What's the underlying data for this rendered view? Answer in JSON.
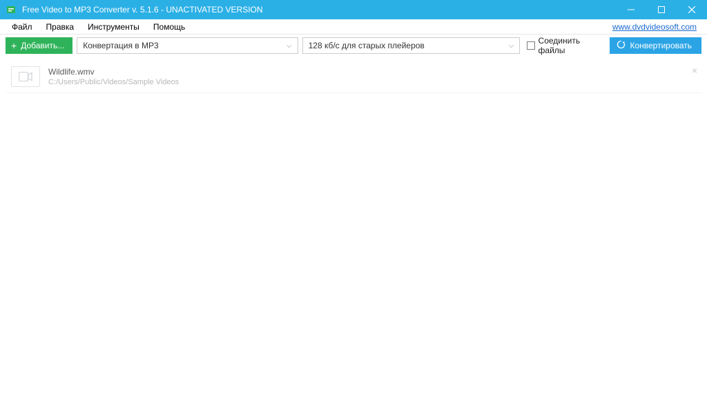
{
  "titlebar": {
    "title": "Free Video to MP3 Converter v. 5.1.6 - UNACTIVATED VERSION"
  },
  "menubar": {
    "file": "Файл",
    "edit": "Правка",
    "tools": "Инструменты",
    "help": "Помощь",
    "site_link": "www.dvdvideosoft.com"
  },
  "toolbar": {
    "add_label": "Добавить...",
    "format_selected": "Конвертация в MP3",
    "bitrate_selected": "128 кб/с для старых плейеров",
    "join_label": "Соединить файлы",
    "convert_label": "Конвертировать"
  },
  "files": [
    {
      "name": "Wildlife.wmv",
      "path": "C:/Users/Public/Videos/Sample Videos"
    }
  ]
}
